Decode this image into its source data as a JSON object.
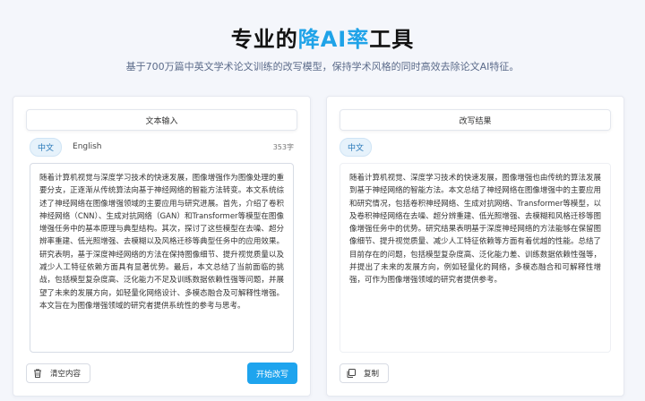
{
  "hero": {
    "title_prefix": "专业的",
    "title_accent": "降AI率",
    "title_suffix": "工具",
    "subtitle": "基于700万篇中英文学术论文训练的改写模型，保持学术风格的同时高效去除论文AI特征。"
  },
  "colors": {
    "accent": "#1fa3e8",
    "primary_button": "#1ea4ee"
  },
  "input_panel": {
    "header": "文本输入",
    "tabs": [
      {
        "label": "中文",
        "active": true
      },
      {
        "label": "English",
        "active": false
      }
    ],
    "char_count": "353字",
    "text": "随着计算机视觉与深度学习技术的快速发展，图像增强作为图像处理的重要分支，正逐渐从传统算法向基于神经网络的智能方法转变。本文系统综述了神经网络在图像增强领域的主要应用与研究进展。首先，介绍了卷积神经网络（CNN）、生成对抗网络（GAN）和Transformer等模型在图像增强任务中的基本原理与典型结构。其次，探讨了这些模型在去噪、超分辨率重建、低光照增强、去模糊以及风格迁移等典型任务中的应用效果。研究表明，基于深度神经网络的方法在保持图像细节、提升视觉质量以及减少人工特征依赖方面具有显著优势。最后，本文总结了当前面临的挑战，包括模型复杂度高、泛化能力不足及训练数据依赖性强等问题，并展望了未来的发展方向，如轻量化网络设计、多模态融合及可解释性增强。本文旨在为图像增强领域的研究者提供系统性的参考与思考。",
    "clear_label": "清空内容",
    "submit_label": "开始改写"
  },
  "output_panel": {
    "header": "改写结果",
    "tabs": [
      {
        "label": "中文",
        "active": true
      }
    ],
    "text": "随着计算机视觉、深度学习技术的快速发展，图像增强也由传统的算法发展到基于神经网络的智能方法。本文总结了神经网络在图像增强中的主要应用和研究情况，包括卷积神经网络、生成对抗网络、Transformer等模型，以及卷积神经网络在去噪、超分辨重建、低光照增强、去模糊和风格迁移等图像增强任务中的优势。研究结果表明基于深度神经网络的方法能够在保留图像细节、提升视觉质量、减少人工特征依赖等方面有着优越的性能。总结了目前存在的问题，包括模型复杂度高、泛化能力差、训练数据依赖性强等，并提出了未来的发展方向，例如轻量化的网络，多模态融合和可解释性增强，可作为图像增强领域的研究者提供参考。",
    "copy_label": "复制"
  },
  "icons": {
    "clear": "trash-icon",
    "copy": "copy-icon"
  }
}
